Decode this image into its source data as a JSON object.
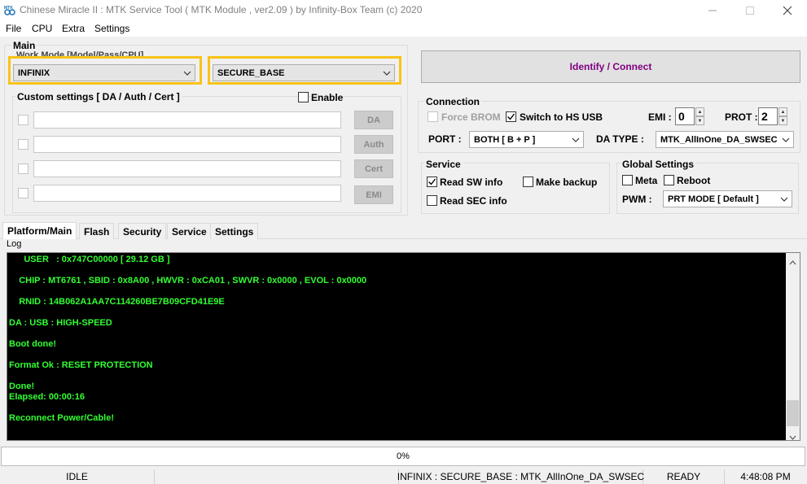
{
  "window": {
    "title": "Chinese Miracle II : MTK Service Tool ( MTK Module , ver2.09  ) by Infinity-Box Team (c) 2020"
  },
  "menu": [
    "File",
    "CPU",
    "Extra",
    "Settings"
  ],
  "main": {
    "group_title": "Main",
    "work_mode_label": "Work Mode [Model/Pass/CPU]",
    "brand_value": "INFINIX",
    "mode_value": "SECURE_BASE",
    "custom_settings_title": "Custom settings [ DA / Auth / Cert ]",
    "enable_label": "Enable",
    "rows": [
      {
        "button": "DA"
      },
      {
        "button": "Auth"
      },
      {
        "button": "Cert"
      },
      {
        "button": "EMI"
      }
    ]
  },
  "identify_button": "Identify / Connect",
  "connection": {
    "title": "Connection",
    "force_brom_label": "Force BROM",
    "switch_hs_label": "Switch to HS USB",
    "emi_label": "EMI :",
    "emi_value": "0",
    "prot_label": "PROT :",
    "prot_value": "2",
    "port_label": "PORT :",
    "port_value": "BOTH [ B + P ]",
    "da_type_label": "DA TYPE :",
    "da_type_value": "MTK_AllInOne_DA_SWSEC"
  },
  "service": {
    "title": "Service",
    "read_sw_label": "Read SW info",
    "make_backup_label": "Make backup",
    "read_sec_label": "Read SEC info"
  },
  "global": {
    "title": "Global Settings",
    "meta_label": "Meta",
    "reboot_label": "Reboot",
    "pwm_label": "PWM :",
    "pwm_value": "PRT MODE [ Default ]"
  },
  "tabs": [
    "Platform/Main",
    "Flash",
    "Security",
    "Service",
    "Settings"
  ],
  "log": {
    "label": "Log",
    "lines": [
      "      USER   : 0x747C00000 [ 29.12 GB ]",
      "    CHIP : MT6761 , SBID : 0x8A00 , HWVR : 0xCA01 , SWVR : 0x0000 , EVOL : 0x0000",
      "    RNID : 14B062A1AA7C114260BE7B09CFD41E9E",
      "DA : USB : HIGH-SPEED",
      "Boot done!",
      "Format Ok : RESET PROTECTION",
      "Done!",
      "Elapsed: 00:00:16",
      "Reconnect Power/Cable!"
    ]
  },
  "progress": {
    "text": "0%",
    "value": 0
  },
  "status": {
    "state": "IDLE",
    "info": "INFINIX : SECURE_BASE : MTK_AllInOne_DA_SWSEC",
    "ready": "READY",
    "time": "4:48:08 PM"
  },
  "colors": {
    "log_text": "#32ff32",
    "highlight": "#f9c318",
    "identify_text": "#800080"
  }
}
